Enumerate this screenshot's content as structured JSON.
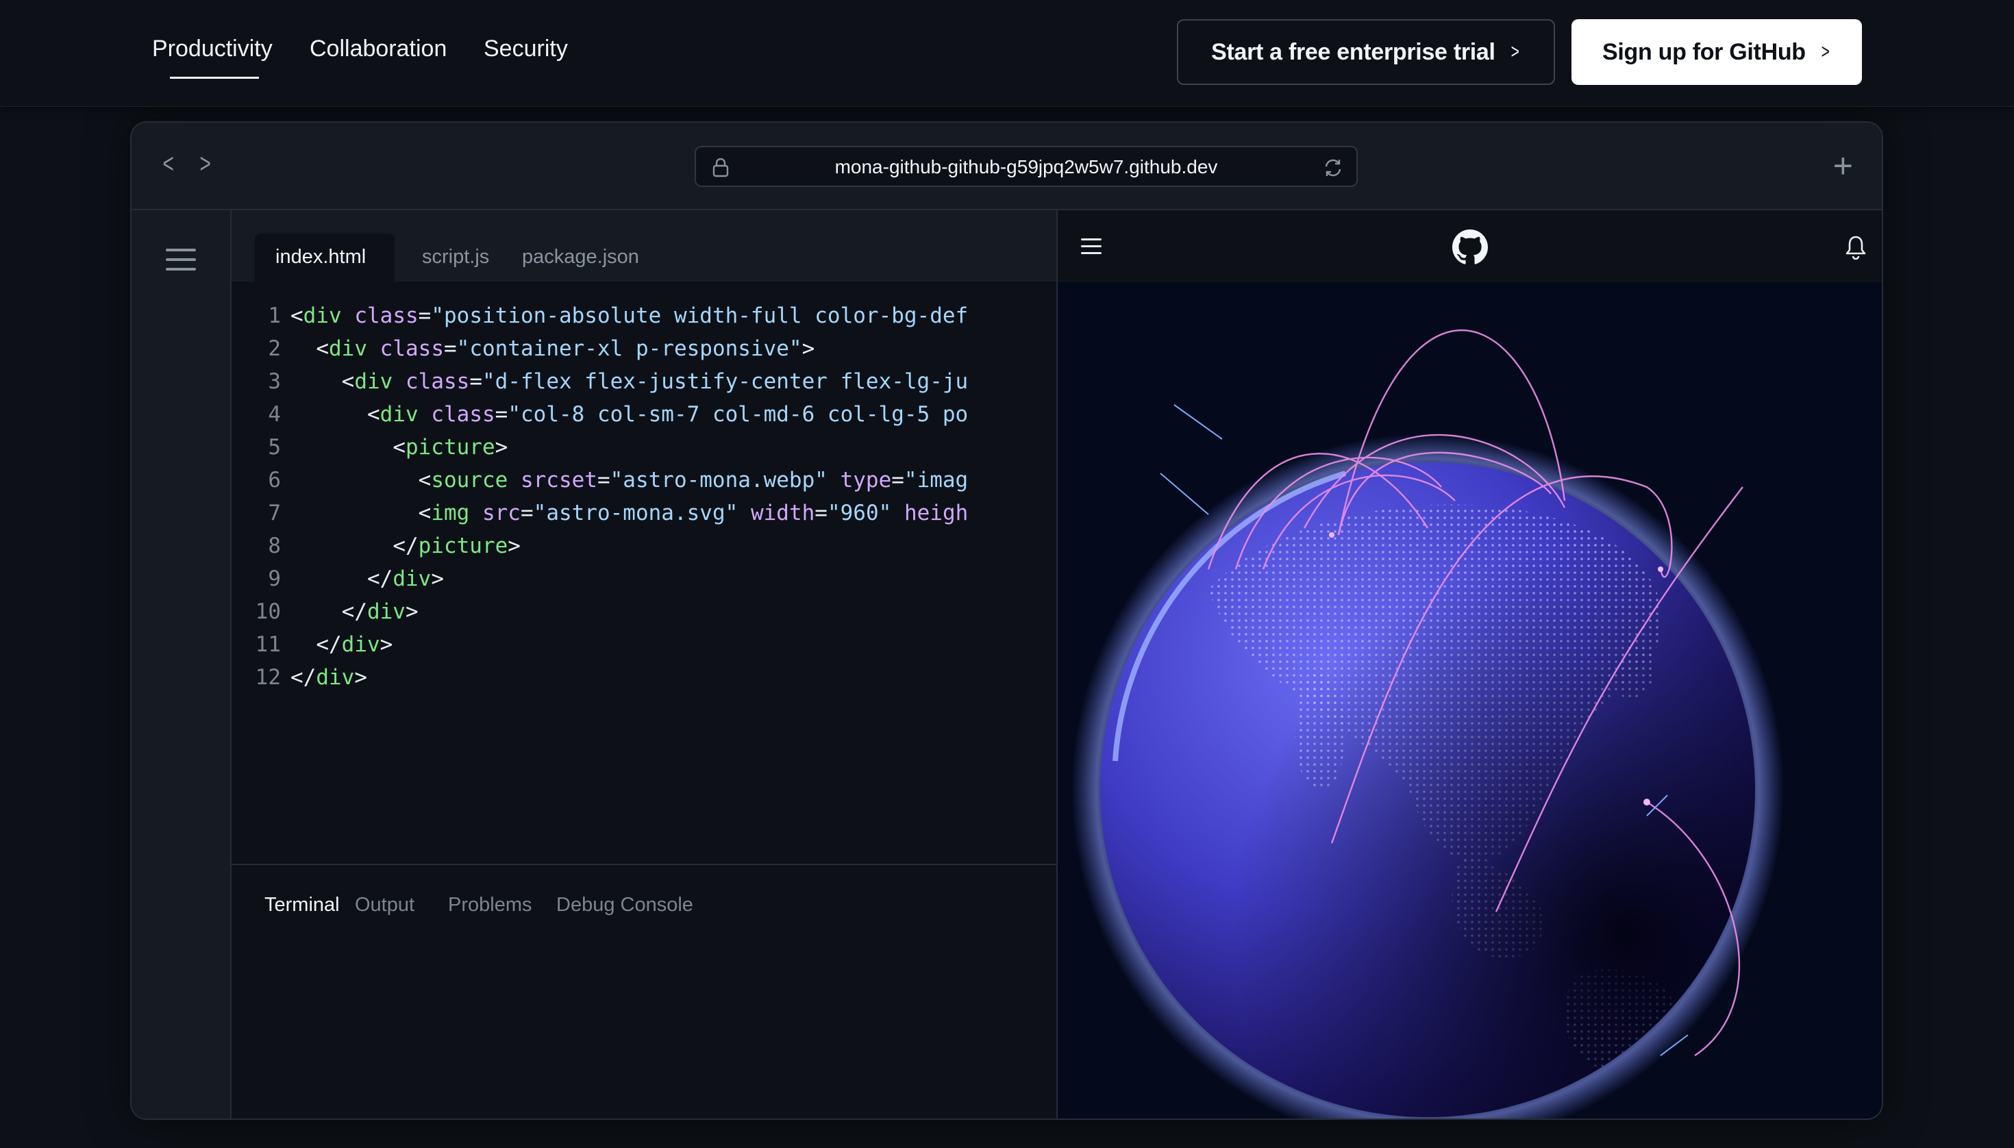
{
  "nav": {
    "tabs": [
      {
        "label": "Productivity",
        "active": true
      },
      {
        "label": "Collaboration",
        "active": false
      },
      {
        "label": "Security",
        "active": false
      }
    ],
    "trial_button": "Start a free enterprise trial",
    "signup_button": "Sign up for GitHub"
  },
  "browser": {
    "url": "mona-github-github-g59jpq2w5w7.github.dev"
  },
  "editor": {
    "tabs": [
      {
        "label": "index.html",
        "active": true
      },
      {
        "label": "script.js",
        "active": false
      },
      {
        "label": "package.json",
        "active": false
      }
    ],
    "code_lines": [
      {
        "num": "1",
        "indent": "",
        "tokens": [
          [
            "p",
            "<"
          ],
          [
            "t",
            "div"
          ],
          [
            "p",
            " "
          ],
          [
            "a",
            "class"
          ],
          [
            "p",
            "="
          ],
          [
            "s",
            "\"position-absolute width-full color-bg-def"
          ]
        ]
      },
      {
        "num": "2",
        "indent": "  ",
        "tokens": [
          [
            "p",
            "<"
          ],
          [
            "t",
            "div"
          ],
          [
            "p",
            " "
          ],
          [
            "a",
            "class"
          ],
          [
            "p",
            "="
          ],
          [
            "s",
            "\"container-xl p-responsive\""
          ],
          [
            "p",
            ">"
          ]
        ]
      },
      {
        "num": "3",
        "indent": "    ",
        "tokens": [
          [
            "p",
            "<"
          ],
          [
            "t",
            "div"
          ],
          [
            "p",
            " "
          ],
          [
            "a",
            "class"
          ],
          [
            "p",
            "="
          ],
          [
            "s",
            "\"d-flex flex-justify-center flex-lg-ju"
          ]
        ]
      },
      {
        "num": "4",
        "indent": "      ",
        "tokens": [
          [
            "p",
            "<"
          ],
          [
            "t",
            "div"
          ],
          [
            "p",
            " "
          ],
          [
            "a",
            "class"
          ],
          [
            "p",
            "="
          ],
          [
            "s",
            "\"col-8 col-sm-7 col-md-6 col-lg-5 po"
          ]
        ]
      },
      {
        "num": "5",
        "indent": "        ",
        "tokens": [
          [
            "p",
            "<"
          ],
          [
            "t",
            "picture"
          ],
          [
            "p",
            ">"
          ]
        ]
      },
      {
        "num": "6",
        "indent": "          ",
        "tokens": [
          [
            "p",
            "<"
          ],
          [
            "t",
            "source"
          ],
          [
            "p",
            " "
          ],
          [
            "a",
            "srcset"
          ],
          [
            "p",
            "="
          ],
          [
            "s",
            "\"astro-mona.webp\""
          ],
          [
            "p",
            " "
          ],
          [
            "a",
            "type"
          ],
          [
            "p",
            "="
          ],
          [
            "s",
            "\"imag"
          ]
        ]
      },
      {
        "num": "7",
        "indent": "          ",
        "tokens": [
          [
            "p",
            "<"
          ],
          [
            "t",
            "img"
          ],
          [
            "p",
            " "
          ],
          [
            "a",
            "src"
          ],
          [
            "p",
            "="
          ],
          [
            "s",
            "\"astro-mona.svg\""
          ],
          [
            "p",
            " "
          ],
          [
            "a",
            "width"
          ],
          [
            "p",
            "="
          ],
          [
            "s",
            "\"960\""
          ],
          [
            "p",
            " "
          ],
          [
            "a",
            "heigh"
          ]
        ]
      },
      {
        "num": "8",
        "indent": "        ",
        "tokens": [
          [
            "p",
            "</"
          ],
          [
            "t",
            "picture"
          ],
          [
            "p",
            ">"
          ]
        ]
      },
      {
        "num": "9",
        "indent": "      ",
        "tokens": [
          [
            "p",
            "</"
          ],
          [
            "t",
            "div"
          ],
          [
            "p",
            ">"
          ]
        ]
      },
      {
        "num": "10",
        "indent": "    ",
        "tokens": [
          [
            "p",
            "</"
          ],
          [
            "t",
            "div"
          ],
          [
            "p",
            ">"
          ]
        ]
      },
      {
        "num": "11",
        "indent": "  ",
        "tokens": [
          [
            "p",
            "</"
          ],
          [
            "t",
            "div"
          ],
          [
            "p",
            ">"
          ]
        ]
      },
      {
        "num": "12",
        "indent": "",
        "tokens": [
          [
            "p",
            "</"
          ],
          [
            "t",
            "div"
          ],
          [
            "p",
            ">"
          ]
        ]
      }
    ],
    "panel_tabs": [
      {
        "label": "Terminal",
        "active": true
      },
      {
        "label": "Output",
        "active": false
      },
      {
        "label": "Problems",
        "active": false
      },
      {
        "label": "Debug Console",
        "active": false
      }
    ]
  },
  "icons": {
    "back": "chevron-left-icon",
    "forward": "chevron-right-icon",
    "lock": "lock-icon",
    "reload": "reload-icon",
    "new_tab": "plus-icon",
    "explorer": "hamburger-menu-icon",
    "preview_menu": "hamburger-menu-icon",
    "preview_logo": "github-logo-icon",
    "notifications": "bell-icon"
  },
  "colors": {
    "background": "#0d1117",
    "syntax_tag": "#7ee787",
    "syntax_attr": "#d2a8ff",
    "syntax_string": "#a5d6ff",
    "globe_blue": "#5b5bf0",
    "arc_pink": "#f08ee8"
  }
}
